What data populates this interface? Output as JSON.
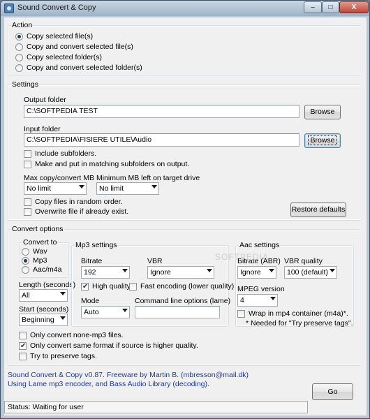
{
  "window": {
    "title": "Sound Convert & Copy",
    "min_symbol": "–",
    "max_symbol": "□",
    "close_symbol": "X"
  },
  "action": {
    "legend": "Action",
    "options": [
      {
        "label": "Copy selected file(s)",
        "selected": true
      },
      {
        "label": "Copy and convert selected file(s)",
        "selected": false
      },
      {
        "label": "Copy selected folder(s)",
        "selected": false
      },
      {
        "label": "Copy and convert selected folder(s)",
        "selected": false
      }
    ]
  },
  "settings": {
    "legend": "Settings",
    "output_folder_label": "Output folder",
    "output_folder_value": "C:\\SOFTPEDIA TEST",
    "browse_label": "Browse",
    "input_folder_label": "Input folder",
    "input_folder_value": "C:\\SOFTPEDIA\\FISIERE UTILE\\Audio",
    "include_subfolders": {
      "label": "Include subfolders.",
      "checked": false
    },
    "matching_subfolders": {
      "label": "Make and put in matching subfolders on output.",
      "checked": false
    },
    "max_copy_label": "Max copy/convert MB",
    "max_copy_value": "No limit",
    "min_left_label": "Minimum MB left on target drive",
    "min_left_value": "No limit",
    "random_order": {
      "label": "Copy files in random order.",
      "checked": false
    },
    "overwrite": {
      "label": "Overwrite file if already exist.",
      "checked": false
    },
    "restore_defaults_label": "Restore defaults"
  },
  "convert": {
    "legend": "Convert options",
    "convert_to": {
      "legend": "Convert to",
      "options": [
        {
          "label": "Wav",
          "selected": false
        },
        {
          "label": "Mp3",
          "selected": true
        },
        {
          "label": "Aac/m4a",
          "selected": false
        }
      ]
    },
    "length_label": "Length (seconds)",
    "length_value": "All",
    "start_label": "Start (seconds)",
    "start_value": "Beginning",
    "mp3": {
      "legend": "Mp3 settings",
      "bitrate_label": "Bitrate",
      "bitrate_value": "192",
      "vbr_label": "VBR",
      "vbr_value": "Ignore",
      "high_quality": {
        "label": "High quality",
        "checked": true
      },
      "fast_encoding": {
        "label": "Fast encoding (lower quality)",
        "checked": false
      },
      "mode_label": "Mode",
      "mode_value": "Auto",
      "cmdline_label": "Command line options (lame)",
      "cmdline_value": ""
    },
    "aac": {
      "legend": "Aac settings",
      "bitrate_label": "Bitrate (ABR)",
      "bitrate_value": "Ignore",
      "vbr_label": "VBR quality",
      "vbr_value": "100 (default)",
      "mpeg_label": "MPEG version",
      "mpeg_value": "4",
      "wrap": {
        "label": "Wrap in mp4 container (m4a)*.",
        "checked": false
      },
      "note": "* Needed for \"Try preserve tags\"."
    },
    "only_none_mp3": {
      "label": "Only convert none-mp3 files.",
      "checked": false
    },
    "only_same_format": {
      "label": "Only convert same format if source is higher quality.",
      "checked": true
    },
    "preserve_tags": {
      "label": "Try to preserve tags.",
      "checked": false
    }
  },
  "footer": {
    "info_line1": "Sound Convert & Copy v0.87. Freeware by Martin B. (mbresson@mail.dk)",
    "info_line2": "Using Lame mp3 encoder, and Bass Audio Library (decoding).",
    "status": "Status: Waiting for user",
    "go_label": "Go"
  },
  "watermark": "SOFTPEDIA"
}
